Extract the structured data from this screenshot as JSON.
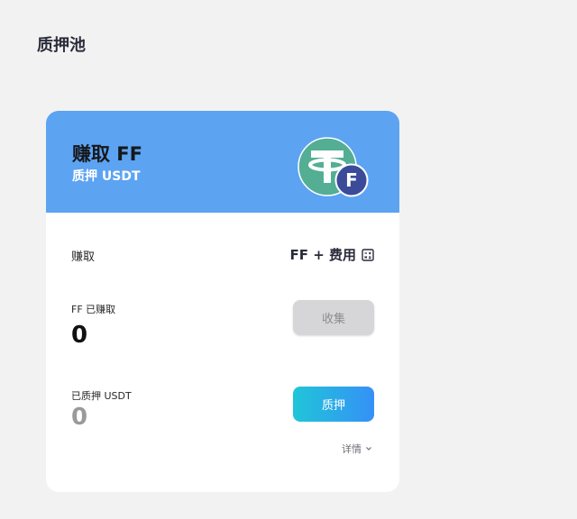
{
  "page": {
    "title": "质押池"
  },
  "card": {
    "header": {
      "title": "赚取 FF",
      "subtitle": "质押 USDT",
      "token_icon": "usdt-tether-icon",
      "badge_icon": "ff-token-icon",
      "badge_letter": "F"
    },
    "earn_row": {
      "label": "赚取",
      "value": "FF + 费用",
      "icon": "calculator-icon"
    },
    "earned": {
      "label": "FF 已赚取",
      "value": "0",
      "button": "收集"
    },
    "staked": {
      "label": "已质押 USDT",
      "value": "0",
      "button": "质押"
    },
    "details": {
      "label": "详情",
      "icon": "chevron-down-icon"
    }
  },
  "colors": {
    "header_bg": "#5ca3f2",
    "tether_green": "#53ae94",
    "badge_bg": "#3b4b9a",
    "harvest_disabled": "#d6d6d8",
    "stake_gradient_start": "#20c5d8",
    "stake_gradient_end": "#3591f7"
  }
}
